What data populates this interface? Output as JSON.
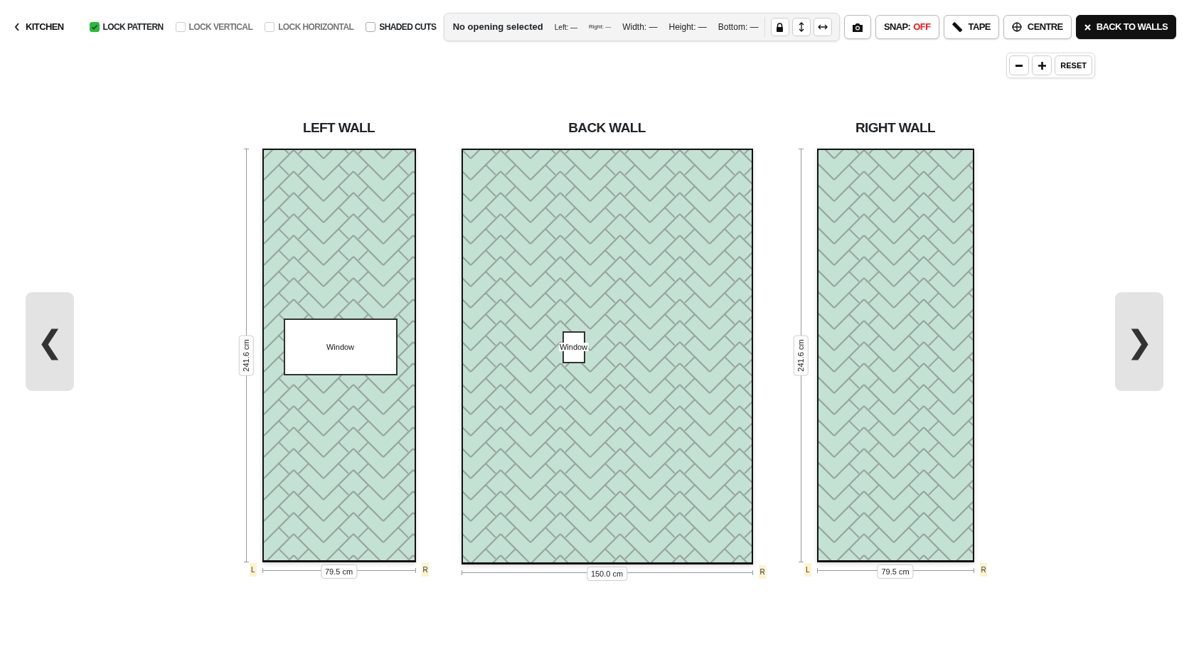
{
  "back_link": {
    "label": "KITCHEN"
  },
  "toggles": [
    {
      "label": "LOCK PATTERN",
      "checked": true,
      "disabled": false
    },
    {
      "label": "LOCK VERTICAL",
      "checked": false,
      "disabled": true
    },
    {
      "label": "LOCK HORIZONTAL",
      "checked": false,
      "disabled": true
    },
    {
      "label": "SHADED CUTS",
      "checked": false,
      "disabled": false
    }
  ],
  "opening_panel": {
    "title": "No opening selected",
    "fields": [
      {
        "label": "Left: —",
        "kind": "compact"
      },
      {
        "label": "Right: —",
        "kind": "tiny"
      },
      {
        "label": "Width: —",
        "kind": "regular"
      },
      {
        "label": "Height: —",
        "kind": "regular"
      },
      {
        "label": "Bottom: —",
        "kind": "regular"
      }
    ],
    "buttons": [
      {
        "kind": "lock"
      },
      {
        "kind": "vertical"
      },
      {
        "kind": "horizontal"
      }
    ]
  },
  "tools": [
    {
      "kind": "camera"
    },
    {
      "kind": "snap",
      "label": "SNAP:",
      "value": "OFF",
      "on": false
    },
    {
      "kind": "tape",
      "label": "TAPE"
    },
    {
      "kind": "centre",
      "label": "CENTRE"
    },
    {
      "kind": "close",
      "label": "BACK TO WALLS"
    }
  ],
  "zoom_controls": [
    {
      "kind": "minus"
    },
    {
      "kind": "plus"
    },
    {
      "kind": "text",
      "label": "RESET"
    }
  ],
  "nav": {
    "prev": "❮",
    "next": "❯"
  },
  "walls": [
    {
      "title": "LEFT WALL",
      "height_label": "241.6 cm",
      "width_label": "79.5 cm",
      "left_mark": "L",
      "right_mark": "R",
      "openings": [
        {
          "label": "Window"
        }
      ]
    },
    {
      "title": "BACK WALL",
      "width_label": "150.0 cm",
      "right_mark": "R",
      "openings": [
        {
          "label": "Window"
        }
      ]
    },
    {
      "title": "RIGHT WALL",
      "height_label": "241.6 cm",
      "width_label": "79.5 cm",
      "left_mark": "L",
      "right_mark": "R"
    }
  ]
}
